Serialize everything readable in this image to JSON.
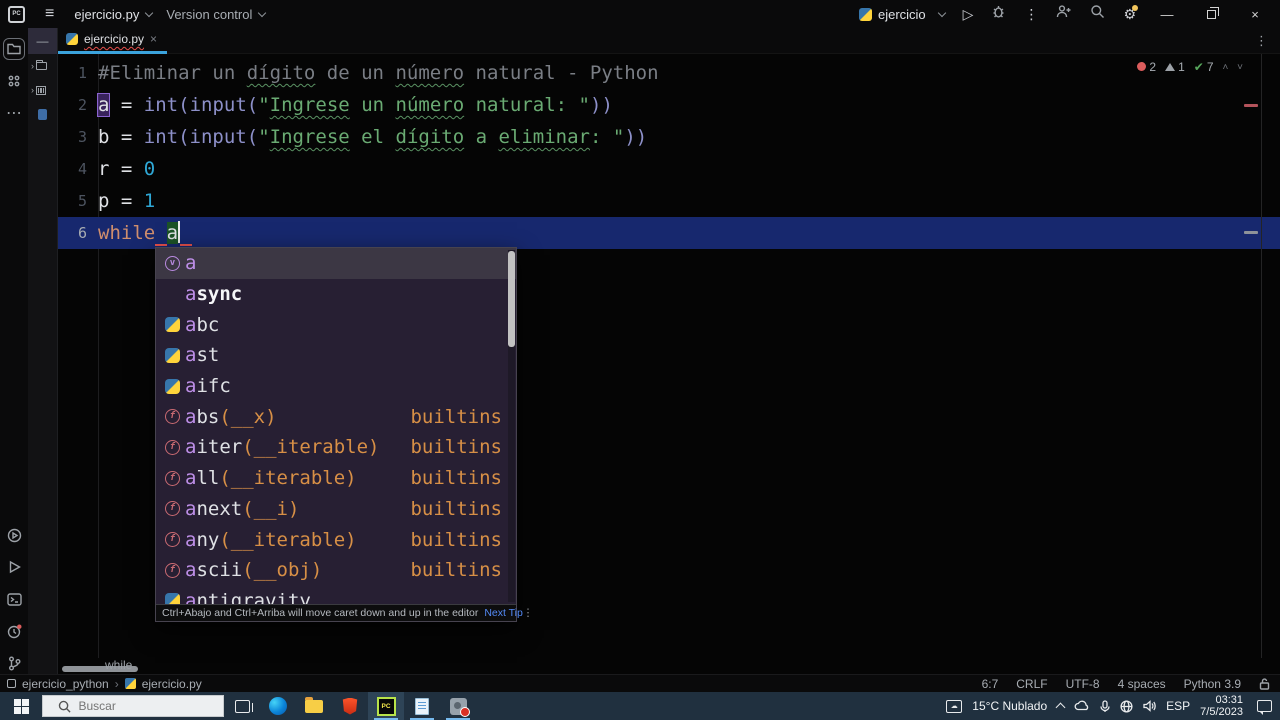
{
  "icons": {
    "hamburger": "≡",
    "more_vertical": "⋮",
    "close": "×",
    "minimize": "—",
    "run": "▷",
    "gear": "⚙",
    "tab_close": "×"
  },
  "title_bar": {
    "project_selector": "ejercicio.py",
    "version_control": "Version control",
    "run_config": "ejercicio"
  },
  "tab": {
    "name": "ejercicio.py"
  },
  "inspections": {
    "errors": "2",
    "warnings": "1",
    "typos": "7"
  },
  "editor": {
    "breadcrumb": "while",
    "lines": [
      {
        "num": "1",
        "active": false,
        "tokens": [
          {
            "t": "#Eliminar un ",
            "s": "c"
          },
          {
            "t": "dígito",
            "s": "c ty"
          },
          {
            "t": " de un ",
            "s": "c"
          },
          {
            "t": "número",
            "s": "c ty"
          },
          {
            "t": " natural - Python",
            "s": "c"
          }
        ]
      },
      {
        "num": "2",
        "active": false,
        "tokens": [
          {
            "t": "a",
            "s": "p occ"
          },
          {
            "t": " = ",
            "s": "p"
          },
          {
            "t": "int",
            "s": "f"
          },
          {
            "t": "(",
            "s": "f"
          },
          {
            "t": "input",
            "s": "f"
          },
          {
            "t": "(",
            "s": "f"
          },
          {
            "t": "\"",
            "s": "s"
          },
          {
            "t": "Ingrese",
            "s": "s ty"
          },
          {
            "t": " un ",
            "s": "s"
          },
          {
            "t": "número",
            "s": "s ty"
          },
          {
            "t": " natural: ",
            "s": "s"
          },
          {
            "t": "\"",
            "s": "s"
          },
          {
            "t": "))",
            "s": "f"
          }
        ]
      },
      {
        "num": "3",
        "active": false,
        "tokens": [
          {
            "t": "b = ",
            "s": "p"
          },
          {
            "t": "int",
            "s": "f"
          },
          {
            "t": "(",
            "s": "f"
          },
          {
            "t": "input",
            "s": "f"
          },
          {
            "t": "(",
            "s": "f"
          },
          {
            "t": "\"",
            "s": "s"
          },
          {
            "t": "Ingrese",
            "s": "s ty"
          },
          {
            "t": " el ",
            "s": "s"
          },
          {
            "t": "dígito",
            "s": "s ty"
          },
          {
            "t": " a ",
            "s": "s"
          },
          {
            "t": "eliminar",
            "s": "s ty"
          },
          {
            "t": ": ",
            "s": "s"
          },
          {
            "t": "\"",
            "s": "s"
          },
          {
            "t": "))",
            "s": "f"
          }
        ]
      },
      {
        "num": "4",
        "active": false,
        "tokens": [
          {
            "t": "r = ",
            "s": "p"
          },
          {
            "t": "0",
            "s": "n"
          }
        ]
      },
      {
        "num": "5",
        "active": false,
        "tokens": [
          {
            "t": "p = ",
            "s": "p"
          },
          {
            "t": "1",
            "s": "n"
          }
        ]
      },
      {
        "num": "6",
        "active": true,
        "tokens": [
          {
            "t": "while",
            "s": "k"
          },
          {
            "t": " ",
            "s": "p err"
          },
          {
            "t": "a",
            "s": "mt"
          },
          {
            "t": "",
            "s": "caret"
          },
          {
            "t": " ",
            "s": "p err"
          }
        ]
      }
    ]
  },
  "popup": {
    "items": [
      {
        "icon": "variable",
        "match": "a",
        "rest": "",
        "params": "",
        "tail": "",
        "selected": true,
        "kw": false
      },
      {
        "icon": "none",
        "match": "a",
        "rest": "sync",
        "params": "",
        "tail": "",
        "selected": false,
        "kw": true
      },
      {
        "icon": "python",
        "match": "a",
        "rest": "bc",
        "params": "",
        "tail": "",
        "selected": false,
        "kw": false
      },
      {
        "icon": "python",
        "match": "a",
        "rest": "st",
        "params": "",
        "tail": "",
        "selected": false,
        "kw": false
      },
      {
        "icon": "python",
        "match": "a",
        "rest": "ifc",
        "params": "",
        "tail": "",
        "selected": false,
        "kw": false
      },
      {
        "icon": "function",
        "match": "a",
        "rest": "bs",
        "params": "(__x)",
        "tail": "builtins",
        "selected": false,
        "kw": false
      },
      {
        "icon": "function",
        "match": "a",
        "rest": "iter",
        "params": "(__iterable)",
        "tail": "builtins",
        "selected": false,
        "kw": false
      },
      {
        "icon": "function",
        "match": "a",
        "rest": "ll",
        "params": "(__iterable)",
        "tail": "builtins",
        "selected": false,
        "kw": false
      },
      {
        "icon": "function",
        "match": "a",
        "rest": "next",
        "params": "(__i)",
        "tail": "builtins",
        "selected": false,
        "kw": false
      },
      {
        "icon": "function",
        "match": "a",
        "rest": "ny",
        "params": "(__iterable)",
        "tail": "builtins",
        "selected": false,
        "kw": false
      },
      {
        "icon": "function",
        "match": "a",
        "rest": "scii",
        "params": "(__obj)",
        "tail": "builtins",
        "selected": false,
        "kw": false
      },
      {
        "icon": "python",
        "match": "a",
        "rest": "ntigravity",
        "params": "",
        "tail": "",
        "selected": false,
        "kw": false
      }
    ],
    "tip": {
      "text": "Ctrl+Abajo and Ctrl+Arriba will move caret down and up in the editor",
      "link": "Next Tip"
    }
  },
  "status_bar": {
    "project": "ejercicio_python",
    "file": "ejercicio.py",
    "right": [
      "6:7",
      "CRLF",
      "UTF-8",
      "4 spaces",
      "Python 3.9"
    ]
  },
  "taskbar": {
    "search_placeholder": "Buscar",
    "weather": "15°C Nublado",
    "language": "ESP",
    "time": "03:31",
    "date": "7/5/2023"
  }
}
